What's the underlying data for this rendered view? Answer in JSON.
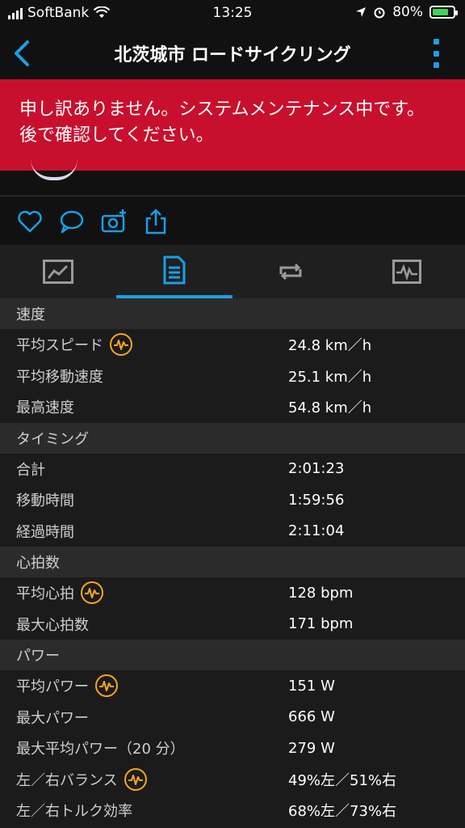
{
  "status_bar": {
    "carrier": "SoftBank",
    "time": "13:25",
    "battery": "80%",
    "battery_level": 0.8
  },
  "header": {
    "title": "北茨城市 ロードサイクリング"
  },
  "banner": {
    "message": "申し訳ありません。システムメンテナンス中です。後で確認してください。"
  },
  "colors": {
    "accent": "#19a0e6",
    "banner": "#c8102e",
    "heart_icon": "#f5a623"
  },
  "sections": [
    {
      "title": "速度",
      "rows": [
        {
          "label": "平均スピード",
          "value": "24.8 km／h",
          "icon": "heart-rate-icon"
        },
        {
          "label": "平均移動速度",
          "value": "25.1 km／h"
        },
        {
          "label": "最高速度",
          "value": "54.8 km／h"
        }
      ]
    },
    {
      "title": "タイミング",
      "rows": [
        {
          "label": "合計",
          "value": "2:01:23"
        },
        {
          "label": "移動時間",
          "value": "1:59:56"
        },
        {
          "label": "経過時間",
          "value": "2:11:04"
        }
      ]
    },
    {
      "title": "心拍数",
      "rows": [
        {
          "label": "平均心拍",
          "value": "128 bpm",
          "icon": "heart-rate-icon"
        },
        {
          "label": "最大心拍数",
          "value": "171 bpm"
        }
      ]
    },
    {
      "title": "パワー",
      "rows": [
        {
          "label": "平均パワー",
          "value": "151 W",
          "icon": "heart-rate-icon"
        },
        {
          "label": "最大パワー",
          "value": "666 W"
        },
        {
          "label": "最大平均パワー（20 分）",
          "value": "279 W"
        },
        {
          "label": "左／右バランス",
          "value": "49%左／51%右",
          "icon": "heart-rate-icon"
        },
        {
          "label": "左／右トルク効率",
          "value": "68%左／73%右"
        }
      ]
    }
  ]
}
